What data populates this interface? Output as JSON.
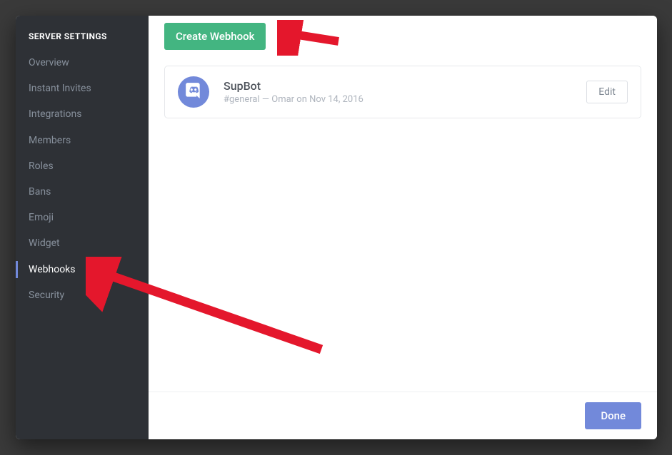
{
  "sidebar": {
    "title": "SERVER SETTINGS",
    "items": [
      {
        "label": "Overview",
        "key": "overview"
      },
      {
        "label": "Instant Invites",
        "key": "instant-invites"
      },
      {
        "label": "Integrations",
        "key": "integrations"
      },
      {
        "label": "Members",
        "key": "members"
      },
      {
        "label": "Roles",
        "key": "roles"
      },
      {
        "label": "Bans",
        "key": "bans"
      },
      {
        "label": "Emoji",
        "key": "emoji"
      },
      {
        "label": "Widget",
        "key": "widget"
      },
      {
        "label": "Webhooks",
        "key": "webhooks",
        "active": true
      },
      {
        "label": "Security",
        "key": "security"
      }
    ]
  },
  "toolbar": {
    "create_label": "Create Webhook"
  },
  "webhook": {
    "name": "SupBot",
    "meta": "#general — Omar on Nov 14, 2016",
    "edit_label": "Edit"
  },
  "footer": {
    "done_label": "Done"
  },
  "colors": {
    "accent": "#7289da",
    "success": "#43b581",
    "sidebar_bg": "#2e3136"
  }
}
